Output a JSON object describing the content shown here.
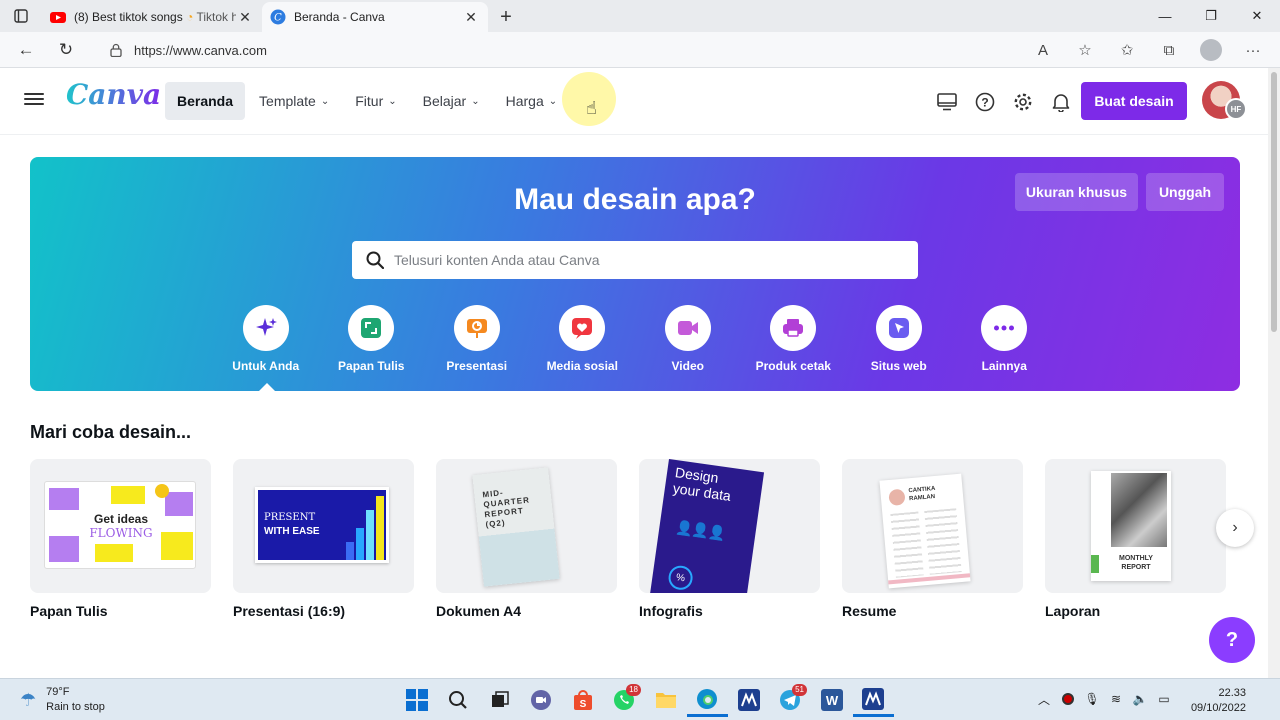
{
  "browser": {
    "tabs": [
      {
        "label": "(8) Best tiktok songs",
        "label2": "Tiktok h"
      },
      {
        "label": "Beranda - Canva"
      }
    ],
    "url": "https://www.canva.com"
  },
  "header": {
    "logo": "Canva",
    "nav": [
      {
        "label": "Beranda"
      },
      {
        "label": "Template"
      },
      {
        "label": "Fitur"
      },
      {
        "label": "Belajar"
      },
      {
        "label": "Harga"
      }
    ],
    "cta": "Buat desain",
    "avatar_initials": "HF"
  },
  "hero": {
    "title": "Mau desain apa?",
    "custom_size": "Ukuran khusus",
    "upload": "Unggah",
    "search_placeholder": "Telusuri konten Anda atau Canva",
    "categories": [
      {
        "label": "Untuk Anda",
        "icon": "sparkle-icon",
        "color": "#7d2ae8"
      },
      {
        "label": "Papan Tulis",
        "icon": "whiteboard-icon",
        "color": "#1ea672"
      },
      {
        "label": "Presentasi",
        "icon": "presentation-icon",
        "color": "#f5891f"
      },
      {
        "label": "Media sosial",
        "icon": "heart-icon",
        "color": "#f0363f"
      },
      {
        "label": "Video",
        "icon": "video-icon",
        "color": "#c45ad9"
      },
      {
        "label": "Produk cetak",
        "icon": "printer-icon",
        "color": "#b23fd6"
      },
      {
        "label": "Situs web",
        "icon": "cursor-icon",
        "color": "#6a5cf0"
      },
      {
        "label": "Lainnya",
        "icon": "more-icon",
        "color": "#7d2ae8"
      }
    ]
  },
  "templates": {
    "title": "Mari coba desain...",
    "items": [
      {
        "label": "Papan Tulis",
        "art": [
          "Get ideas",
          "FLOWING"
        ]
      },
      {
        "label": "Presentasi (16:9)",
        "art": [
          "PRESENT",
          "WITH EASE"
        ]
      },
      {
        "label": "Dokumen A4",
        "art": [
          "MID-",
          "QUARTER",
          "REPORT",
          "(Q2)"
        ]
      },
      {
        "label": "Infografis",
        "art": [
          "Design",
          "your data"
        ]
      },
      {
        "label": "Resume",
        "art": [
          "CANTIKA",
          "RAMLAN"
        ]
      },
      {
        "label": "Laporan",
        "art": [
          "MONTHLY",
          "REPORT"
        ]
      }
    ]
  },
  "help_label": "?",
  "taskbar": {
    "temp": "79°F",
    "weather": "Rain to stop",
    "time": "22.33",
    "date": "09/10/2022",
    "badge_whatsapp": "18",
    "badge_telegram": "51"
  },
  "colors": {
    "accent": "#7d2ae8",
    "brand_teal": "#20c4cb"
  }
}
